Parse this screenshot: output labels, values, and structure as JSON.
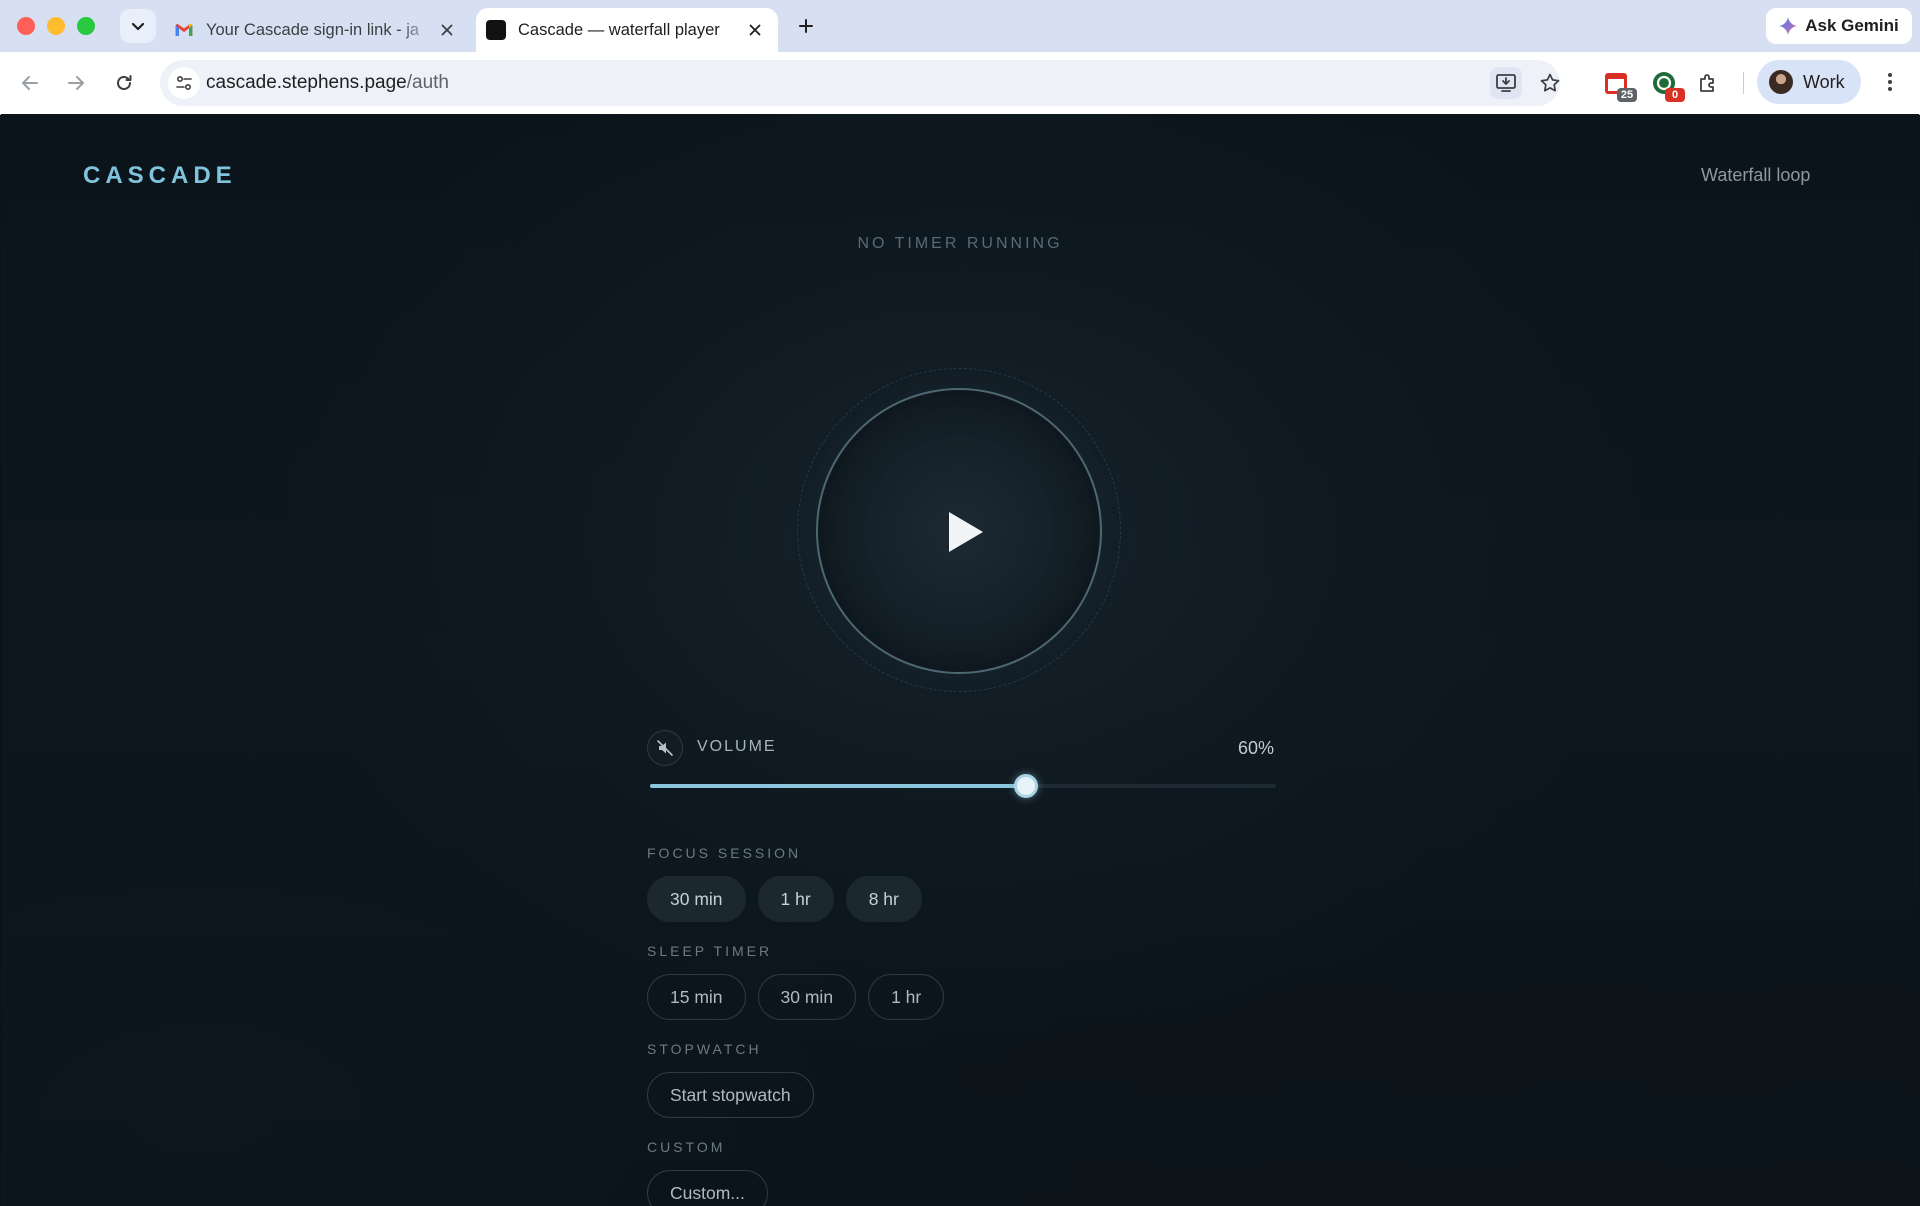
{
  "browser": {
    "tabs": [
      {
        "title": "Your Cascade sign-in link - ja",
        "favicon": "gmail-icon",
        "active": false
      },
      {
        "title": "Cascade — waterfall player",
        "favicon": "cascade-favicon",
        "active": true
      }
    ],
    "gemini_label": "Ask Gemini",
    "url_host": "cascade.stephens.page",
    "url_path": "/auth",
    "extensions": [
      {
        "name": "calendar-extension-icon",
        "badge": "25",
        "badge_color": "#5f6368"
      },
      {
        "name": "chat-extension-icon",
        "badge": "0",
        "badge_color": "#d93025"
      }
    ],
    "profile_label": "Work"
  },
  "page": {
    "logo": "CASCADE",
    "loop_label": "Waterfall loop",
    "timer_status": "NO TIMER RUNNING",
    "volume": {
      "label": "VOLUME",
      "value_text": "60%",
      "level": 0.6
    },
    "focus_session": {
      "label": "FOCUS SESSION",
      "options": [
        "30 min",
        "1 hr",
        "8 hr"
      ]
    },
    "sleep_timer": {
      "label": "SLEEP TIMER",
      "options": [
        "15 min",
        "30 min",
        "1 hr"
      ]
    },
    "stopwatch": {
      "label": "STOPWATCH",
      "button": "Start stopwatch"
    },
    "custom": {
      "label": "CUSTOM",
      "button": "Custom..."
    }
  },
  "colors": {
    "accent": "#7fc4dc",
    "background": "#0a1219",
    "slider_fill": "#8cc6dc"
  }
}
